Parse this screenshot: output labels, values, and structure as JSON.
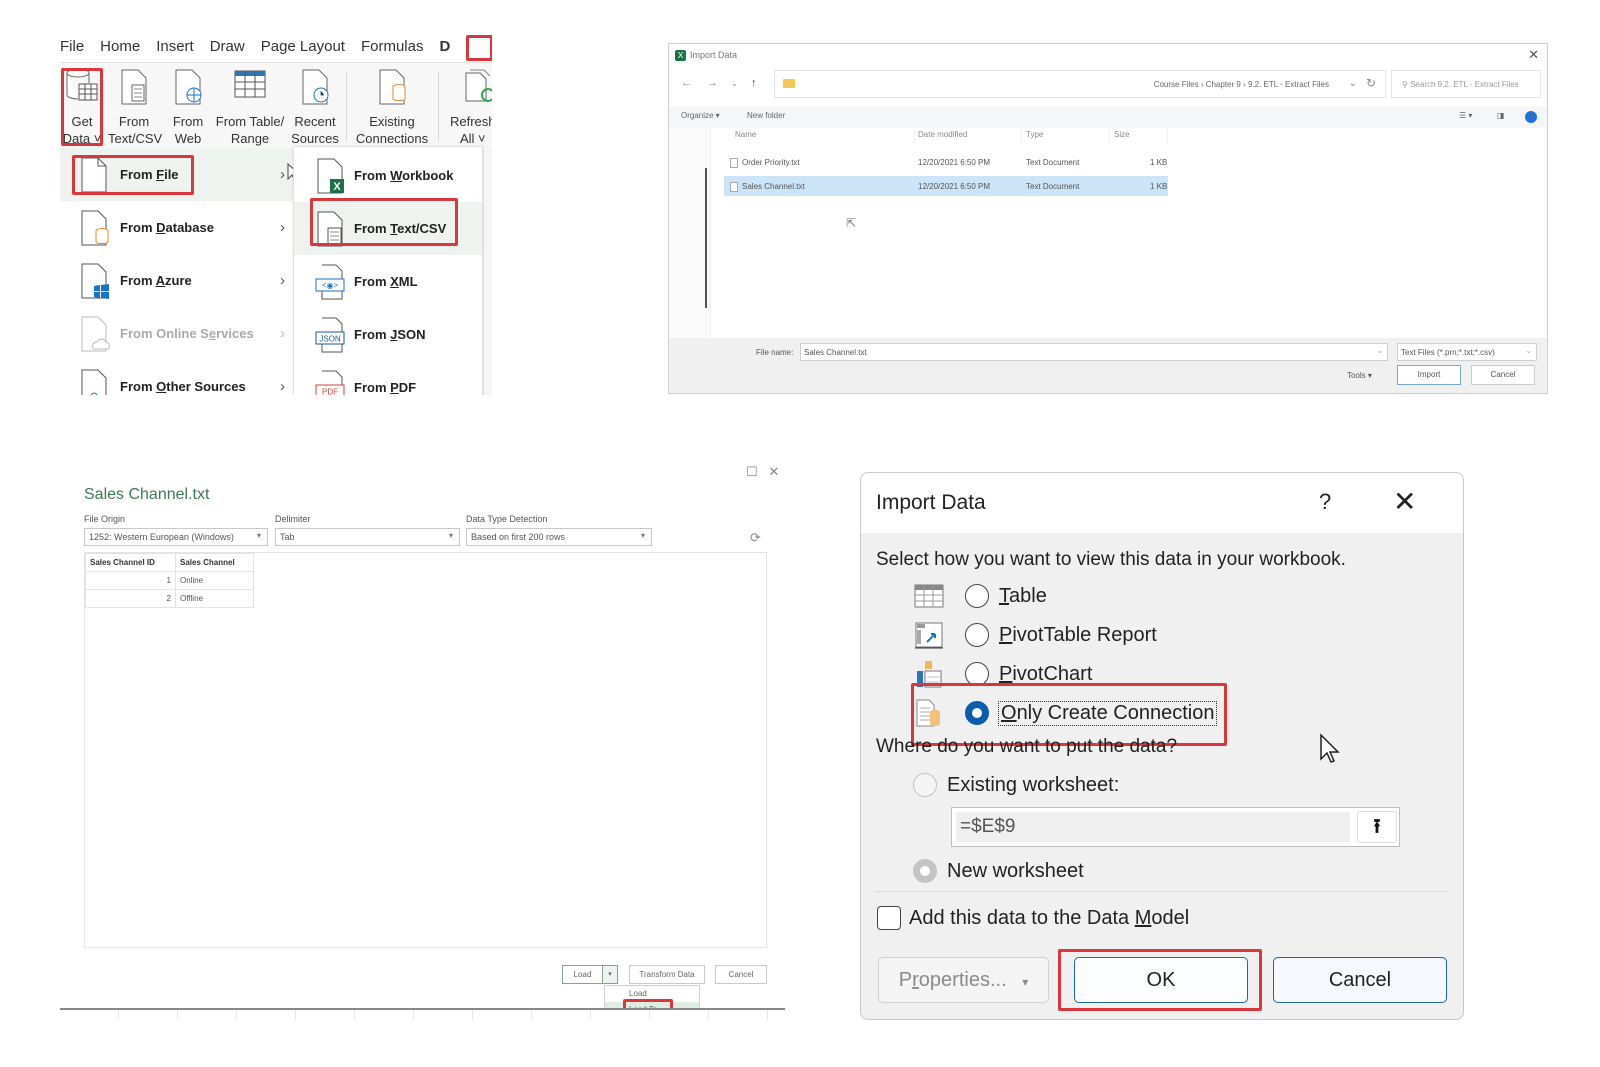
{
  "ribbon": {
    "tabs": [
      "File",
      "Home",
      "Insert",
      "Draw",
      "Page Layout",
      "Formulas",
      "D"
    ],
    "buttons": [
      {
        "line1": "Get",
        "line2": "Data ˅",
        "icon": "database-table-icon"
      },
      {
        "line1": "From",
        "line2": "Text/CSV",
        "icon": "text-file-icon"
      },
      {
        "line1": "From",
        "line2": "Web",
        "icon": "web-globe-icon"
      },
      {
        "line1": "From Table/",
        "line2": "Range",
        "icon": "table-range-icon"
      },
      {
        "line1": "Recent",
        "line2": "Sources",
        "icon": "clock-file-icon"
      },
      {
        "line1": "Existing",
        "line2": "Connections",
        "icon": "connection-file-icon"
      },
      {
        "line1": "Refresh",
        "line2": "All ˅",
        "icon": "refresh-all-icon"
      }
    ],
    "get_data_menu": [
      {
        "pre": "From ",
        "u": "F",
        "post": "ile",
        "icon": "file-icon",
        "highlighted": true
      },
      {
        "pre": "From ",
        "u": "D",
        "post": "atabase",
        "icon": "database-file-icon"
      },
      {
        "pre": "From ",
        "u": "A",
        "post": "zure",
        "icon": "azure-file-icon"
      },
      {
        "pre": "From Online S",
        "u": "e",
        "post": "rvices",
        "icon": "cloud-file-icon",
        "disabled": true
      },
      {
        "pre": "From ",
        "u": "O",
        "post": "ther Sources",
        "icon": "other-sources-icon"
      }
    ],
    "from_file_submenu": [
      {
        "pre": "From ",
        "u": "W",
        "post": "orkbook",
        "icon": "excel-workbook-icon"
      },
      {
        "pre": "From ",
        "u": "T",
        "post": "ext/CSV",
        "icon": "text-csv-icon",
        "highlighted": true
      },
      {
        "pre": "From ",
        "u": "X",
        "post": "ML",
        "icon": "xml-file-icon"
      },
      {
        "pre": "From ",
        "u": "J",
        "post": "SON",
        "icon": "json-file-icon"
      },
      {
        "pre": "From ",
        "u": "P",
        "post": "DF",
        "icon": "pdf-file-icon"
      }
    ]
  },
  "file_dialog": {
    "title": "Import Data",
    "breadcrumb": "Course Files  ›  Chapter 9  ›  9.2. ETL - Extract Files",
    "search_placeholder": "Search 9.2. ETL - Extract Files",
    "organize": "Organize ▾",
    "new_folder": "New folder",
    "columns": [
      "Name",
      "Date modified",
      "Type",
      "Size"
    ],
    "files": [
      {
        "name": "Order Priority.txt",
        "date": "12/20/2021 6:50 PM",
        "type": "Text Document",
        "size": "1 KB",
        "selected": false
      },
      {
        "name": "Sales Channel.txt",
        "date": "12/20/2021 6:50 PM",
        "type": "Text Document",
        "size": "1 KB",
        "selected": true
      }
    ],
    "file_name_label": "File name:",
    "file_name_value": "Sales Channel.txt",
    "file_type": "Text Files (*.prn;*.txt;*.csv)",
    "tools": "Tools  ▾",
    "import": "Import",
    "cancel": "Cancel"
  },
  "preview": {
    "title": "Sales Channel.txt",
    "file_origin_label": "File Origin",
    "file_origin_value": "1252: Western European (Windows)",
    "delimiter_label": "Delimiter",
    "delimiter_value": "Tab",
    "detection_label": "Data Type Detection",
    "detection_value": "Based on first 200 rows",
    "table": {
      "headers": [
        "Sales Channel ID",
        "Sales Channel"
      ],
      "rows": [
        [
          "1",
          "Online"
        ],
        [
          "2",
          "Offline"
        ]
      ]
    },
    "load": "Load",
    "transform": "Transform Data",
    "cancel": "Cancel",
    "load_menu": [
      "Load",
      "Load To..."
    ]
  },
  "import_dialog": {
    "title": "Import Data",
    "help": "?",
    "close": "✕",
    "view_prompt": "Select how you want to view this data in your workbook.",
    "view_options": [
      {
        "u": "T",
        "post": "able",
        "selected": false
      },
      {
        "u": "P",
        "post": "ivotTable Report",
        "selected": false
      },
      {
        "u": "P",
        "post": "ivotChart",
        "selected": false
      },
      {
        "u": "O",
        "post": "nly Create Connection",
        "selected": true
      }
    ],
    "location_prompt": "Where do you want to put the data?",
    "existing_worksheet": "Existing worksheet:",
    "cell_reference": "=$E$9",
    "new_worksheet": "New worksheet",
    "data_model_pre": "Add this data to the Data ",
    "data_model_u": "M",
    "data_model_post": "odel",
    "data_model_checked": false,
    "properties_pre": "P",
    "properties_u": "r",
    "properties_post": "operties...",
    "ok": "OK",
    "cancel": "Cancel"
  },
  "colors": {
    "highlight_red": "#d9363e",
    "radio_selected": "#0b5cad",
    "selection_blue": "#cce4f7",
    "pq_green": "#3d7a54"
  }
}
